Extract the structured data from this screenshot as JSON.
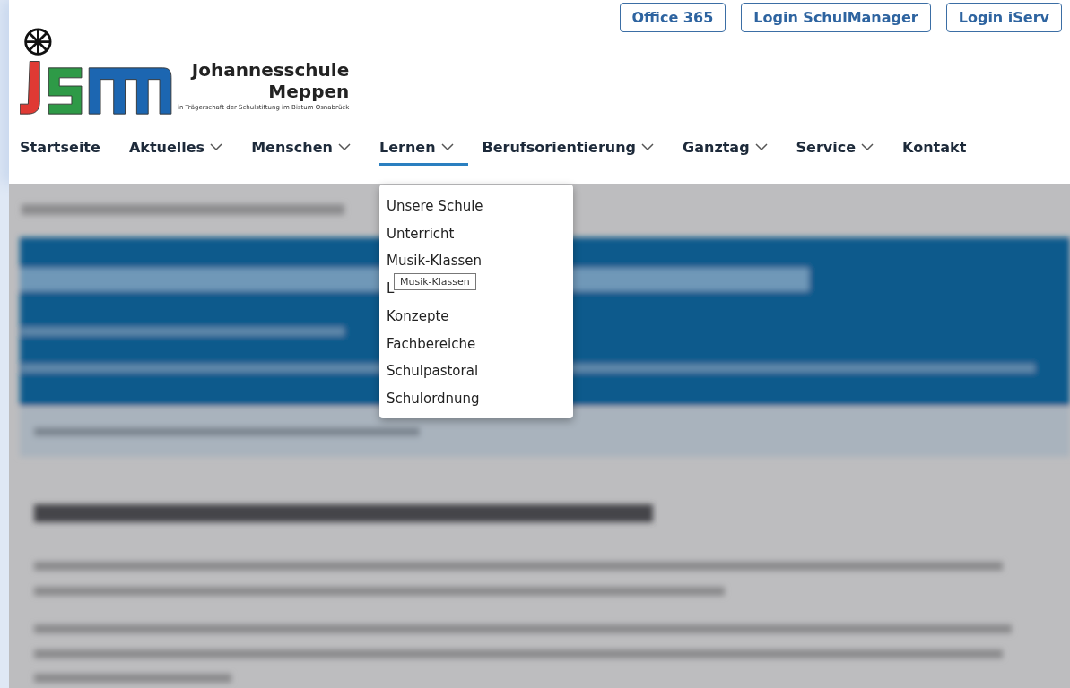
{
  "top_links": [
    "Office 365",
    "Login SchulManager",
    "Login iServ"
  ],
  "logo": {
    "name_line_1": "Johannesschule",
    "name_line_2": "Meppen",
    "subtitle": "in Trägerschaft der Schulstiftung im Bistum Osnabrück"
  },
  "nav": [
    {
      "label": "Startseite",
      "dropdown": false,
      "selected": false
    },
    {
      "label": "Aktuelles",
      "dropdown": true,
      "selected": false
    },
    {
      "label": "Menschen",
      "dropdown": true,
      "selected": false
    },
    {
      "label": "Lernen",
      "dropdown": true,
      "selected": true
    },
    {
      "label": "Berufsorientierung",
      "dropdown": true,
      "selected": false
    },
    {
      "label": "Ganztag",
      "dropdown": true,
      "selected": false
    },
    {
      "label": "Service",
      "dropdown": true,
      "selected": false
    },
    {
      "label": "Kontakt",
      "dropdown": false,
      "selected": false
    }
  ],
  "dropdown_menu": {
    "items": [
      "Unsere Schule",
      "Unterricht",
      "Musik-Klassen",
      "L",
      "Konzepte",
      "Fachbereiche",
      "Schulpastoral",
      "Schulordnung"
    ],
    "tooltip": "Musik-Klassen"
  }
}
